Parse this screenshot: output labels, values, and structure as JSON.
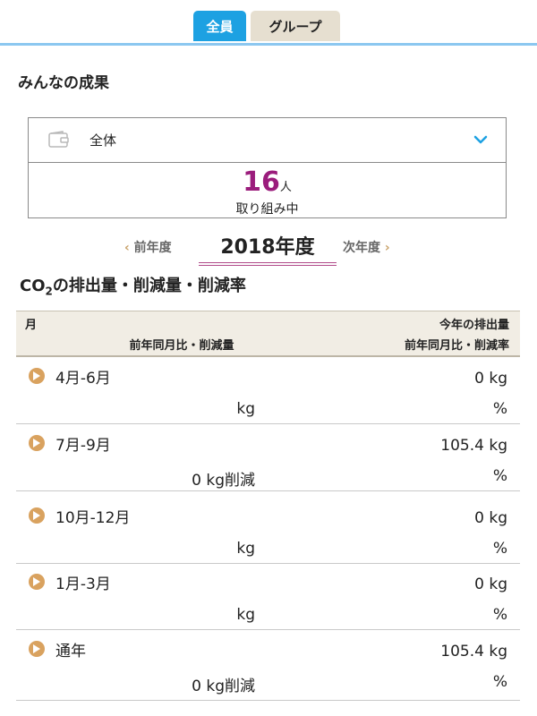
{
  "tabs": [
    {
      "label": "全員",
      "active": true
    },
    {
      "label": "グループ",
      "active": false
    }
  ],
  "section_title": "みんなの成果",
  "group_select": {
    "selected": "全体"
  },
  "participants": {
    "count": "16",
    "unit": "人",
    "label": "取り組み中"
  },
  "year_nav": {
    "prev": "前年度",
    "current": "2018年度",
    "next": "次年度"
  },
  "table_title": {
    "prefix": "CO",
    "sub": "2",
    "suffix": "の排出量・削減量・削減率"
  },
  "table_header": {
    "month": "月",
    "emission": "今年の排出量",
    "reduction": "前年同月比・削減量",
    "rate": "前年同月比・削減率"
  },
  "rows": [
    {
      "period": "4月-6月",
      "emission": "0 kg",
      "reduction": "kg",
      "rate": "%"
    },
    {
      "period": "7月-9月",
      "emission": "105.4 kg",
      "reduction": "0 kg削減",
      "rate": "%"
    },
    {
      "period": "10月-12月",
      "emission": "0 kg",
      "reduction": "kg",
      "rate": "%"
    },
    {
      "period": "1月-3月",
      "emission": "0 kg",
      "reduction": "kg",
      "rate": "%"
    },
    {
      "period": "通年",
      "emission": "105.4 kg",
      "reduction": "0 kg削減",
      "rate": "%"
    }
  ],
  "colors": {
    "tab_active": "#1da1e2",
    "tab_inactive": "#e6dfd0",
    "count": "#9b1d7c",
    "row_icon": "#d9a25f"
  }
}
